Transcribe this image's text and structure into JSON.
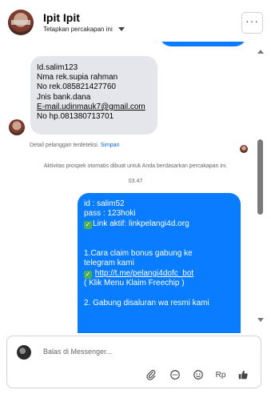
{
  "header": {
    "name": "Ipit Ipit",
    "subtitle": "Tetapkan percakapan ini",
    "more_label": "···"
  },
  "incoming_message": {
    "lines": [
      "Id.salim123",
      "Nma rek.supia rahman",
      "No rek.085821427760",
      "Jnis bank.dana",
      "E-mail.udinmauk7@gmail.com",
      "No hp.081380713701"
    ]
  },
  "detail_note": {
    "text": "Detail pelanggan terdeteksi.",
    "action": "Simpan"
  },
  "activity_note": "Aktivitas prospek otomatis dibuat untuk Anda berdasarkan percakapan ini.",
  "timestamp": "03.47",
  "outgoing_message": {
    "line1": "id : salim52",
    "line2": "pass : 123hoki",
    "line3": "Link aktif: linkpelangi4d.org",
    "line4": "1.Cara claim bonus gabung ke",
    "line5": "telegram kami",
    "line6": "http://t.me/pelangi4dofc_bot",
    "line7": "( Klik Menu Klaim Freechip )",
    "line8": "2. Gabung disaluran wa resmi kami",
    "check_glyph": "✓"
  },
  "composer": {
    "placeholder": "Balas di Messenger...",
    "currency_label": "Rp",
    "icons": [
      "paperclip-icon",
      "chat-bubble-icon",
      "emoji-icon",
      "currency-icon",
      "thumbs-up-icon"
    ]
  },
  "colors": {
    "outgoing_bubble": "#0a7cff",
    "incoming_bubble": "#e4e6eb",
    "link": "#0a64d8"
  }
}
